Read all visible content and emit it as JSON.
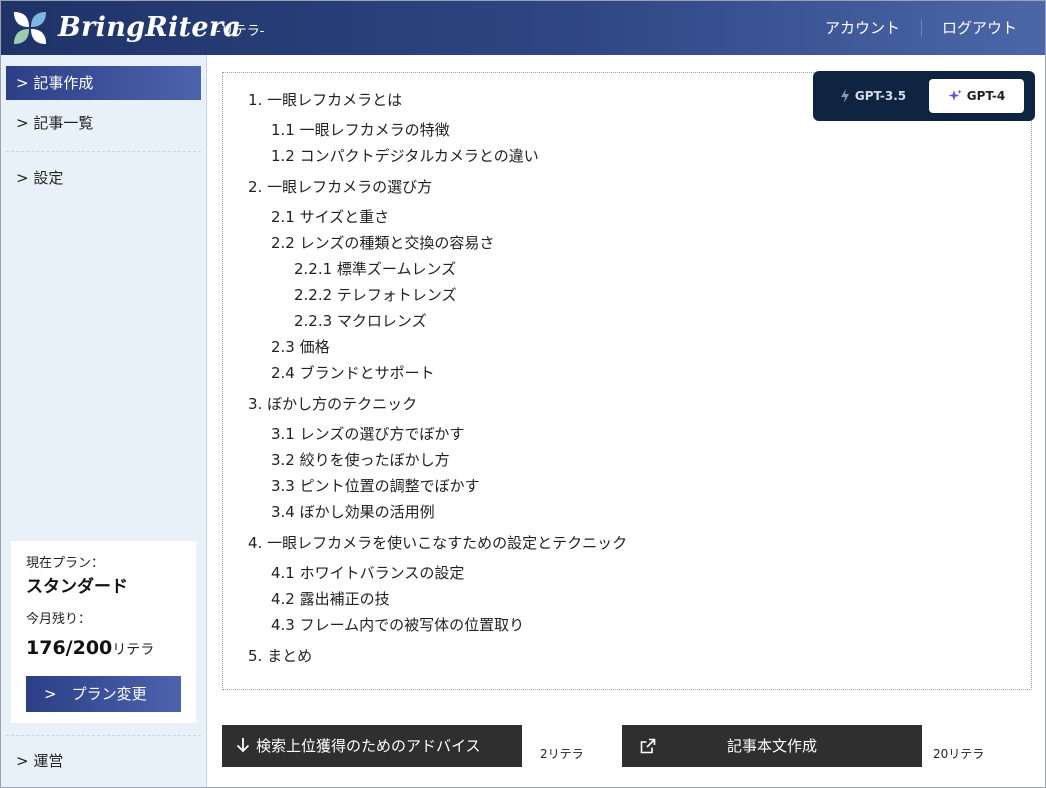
{
  "header": {
    "logo_text": "BringRitera",
    "logo_sub": "-リテラ-",
    "account_link": "アカウント",
    "logout_link": "ログアウト"
  },
  "sidebar": {
    "items": [
      {
        "label": "> 記事作成",
        "active": true
      },
      {
        "label": "> 記事一覧"
      },
      {
        "label": "> 設定"
      }
    ],
    "plan": {
      "current_label": "現在プラン：",
      "plan_name": "スタンダード",
      "remaining_label": "今月残り：",
      "remaining_count": "176/200",
      "remaining_unit": "リテラ",
      "change_button": ">　プラン変更"
    },
    "footer_item": "> 運営"
  },
  "model_toggle": {
    "options": [
      {
        "label": "GPT-3.5",
        "selected": false
      },
      {
        "label": "GPT-4",
        "selected": true
      }
    ]
  },
  "outline": [
    {
      "text": "1. 一眼レフカメラとは",
      "level": 1
    },
    {
      "text": "1.1 一眼レフカメラの特徴",
      "level": 2
    },
    {
      "text": "1.2 コンパクトデジタルカメラとの違い",
      "level": 2
    },
    {
      "text": "2. 一眼レフカメラの選び方",
      "level": 1
    },
    {
      "text": "2.1 サイズと重さ",
      "level": 2
    },
    {
      "text": "2.2 レンズの種類と交換の容易さ",
      "level": 2
    },
    {
      "text": "2.2.1 標準ズームレンズ",
      "level": 3
    },
    {
      "text": "2.2.2 テレフォトレンズ",
      "level": 3
    },
    {
      "text": "2.2.3 マクロレンズ",
      "level": 3
    },
    {
      "text": "2.3 価格",
      "level": 2
    },
    {
      "text": "2.4 ブランドとサポート",
      "level": 2
    },
    {
      "text": "3. ぼかし方のテクニック",
      "level": 1
    },
    {
      "text": "3.1 レンズの選び方でぼかす",
      "level": 2
    },
    {
      "text": "3.2 絞りを使ったぼかし方",
      "level": 2
    },
    {
      "text": "3.3 ピント位置の調整でぼかす",
      "level": 2
    },
    {
      "text": "3.4 ぼかし効果の活用例",
      "level": 2
    },
    {
      "text": "4. 一眼レフカメラを使いこなすための設定とテクニック",
      "level": 1
    },
    {
      "text": "4.1 ホワイトバランスの設定",
      "level": 2
    },
    {
      "text": "4.2 露出補正の技",
      "level": 2
    },
    {
      "text": "4.3 フレーム内での被写体の位置取り",
      "level": 2
    },
    {
      "text": "5. まとめ",
      "level": 1
    }
  ],
  "actions": {
    "seo_advice_button": "検索上位獲得のためのアドバイス",
    "seo_advice_cost": "2リテラ",
    "create_body_button": "記事本文作成",
    "create_body_cost": "20リテラ"
  },
  "colors": {
    "header_start": "#1f3368",
    "header_end": "#4b67a8",
    "accent": "#3b4f9a",
    "sidebar_bg": "#e8f1f9",
    "toggle_bg": "#0f2440",
    "action_button": "#2f2f2f"
  },
  "icons": {
    "logo": "leaf-logo-icon",
    "gpt35": "bolt-icon",
    "gpt4": "sparkles-icon",
    "seo_advice": "arrow-down-icon",
    "create_body": "external-link-icon"
  }
}
